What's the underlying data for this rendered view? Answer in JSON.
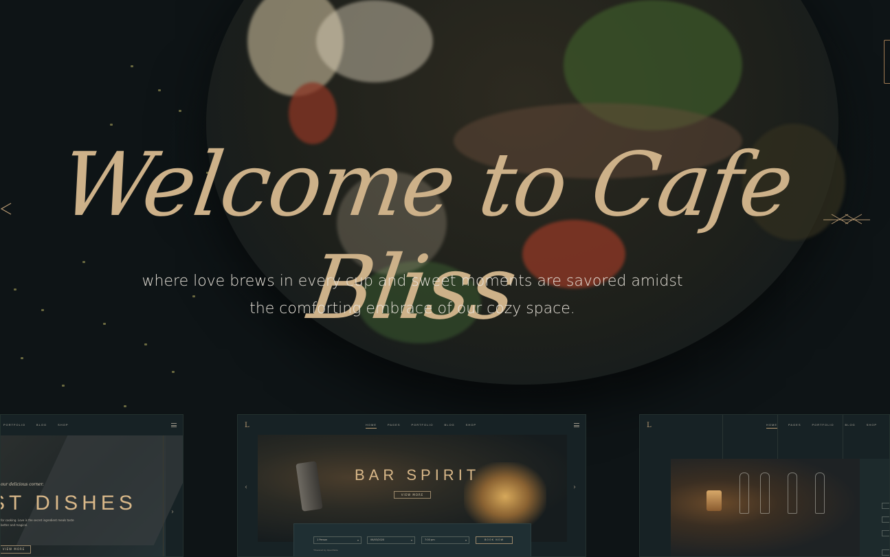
{
  "hero": {
    "title": "Welcome to Cafe Bliss",
    "subtitle_line1": "where love brews in every cup and sweet moments are savored amidst",
    "subtitle_line2": "the comforting embrace of our cozy space.",
    "accent_color": "#cdb189"
  },
  "previews": {
    "card1": {
      "nav": [
        "PORTFOLIO",
        "BLOG",
        "SHOP"
      ],
      "kicker": "our delicious corner.",
      "title": "ST DISHES",
      "text": "for cooking. Love is the secret ingredient meals taste better and magical.",
      "button": "VIEW MORE"
    },
    "card2": {
      "logo": "L",
      "nav": [
        "HOME",
        "PAGES",
        "PORTFOLIO",
        "BLOG",
        "SHOP"
      ],
      "title": "BAR SPIRIT",
      "button": "VIEW MORE",
      "form": {
        "persons": "1 Person",
        "date": "06/03/2020",
        "time": "7:00 pm",
        "book_button": "BOOK NOW",
        "powered": "*Powered by OpenTable"
      }
    },
    "card3": {
      "logo": "L",
      "nav": [
        "HOME",
        "PAGES",
        "PORTFOLIO",
        "BLOG",
        "SHOP"
      ]
    }
  },
  "icons": {
    "arrow_left": "chevron-left-icon",
    "arrow_right": "ornament-arrow-right-icon",
    "menu": "hamburger-icon"
  }
}
